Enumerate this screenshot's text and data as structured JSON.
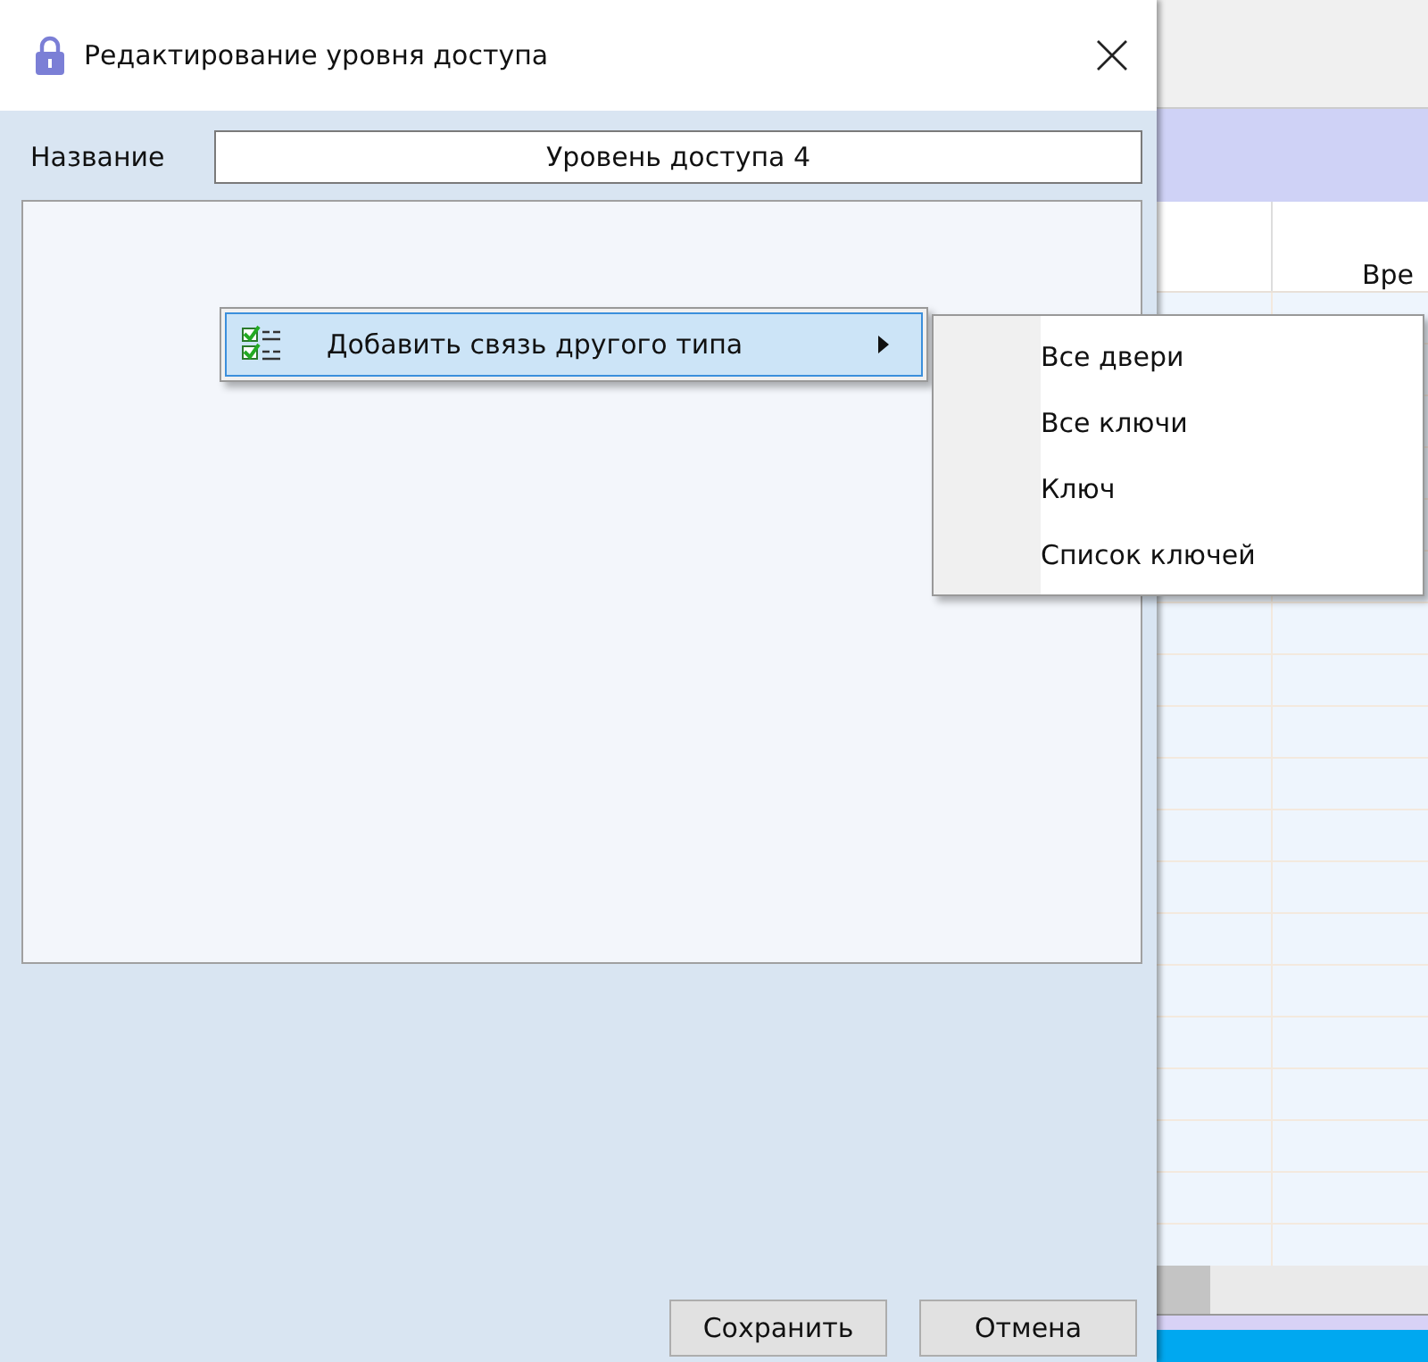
{
  "dialog": {
    "title": "Редактирование уровня доступа",
    "name_label": "Название",
    "name_value": "Уровень доступа 4",
    "buttons": [
      {
        "label": "Сохранить"
      },
      {
        "label": "Отмена"
      }
    ]
  },
  "context_menu": {
    "items": [
      {
        "label": "Добавить связь другого типа",
        "selected": true,
        "has_submenu": true
      }
    ]
  },
  "submenu": {
    "items": [
      {
        "label": "Все двери"
      },
      {
        "label": "Все ключи"
      },
      {
        "label": "Ключ"
      },
      {
        "label": "Список ключей"
      }
    ]
  },
  "background_window": {
    "column_2": "Вре"
  }
}
